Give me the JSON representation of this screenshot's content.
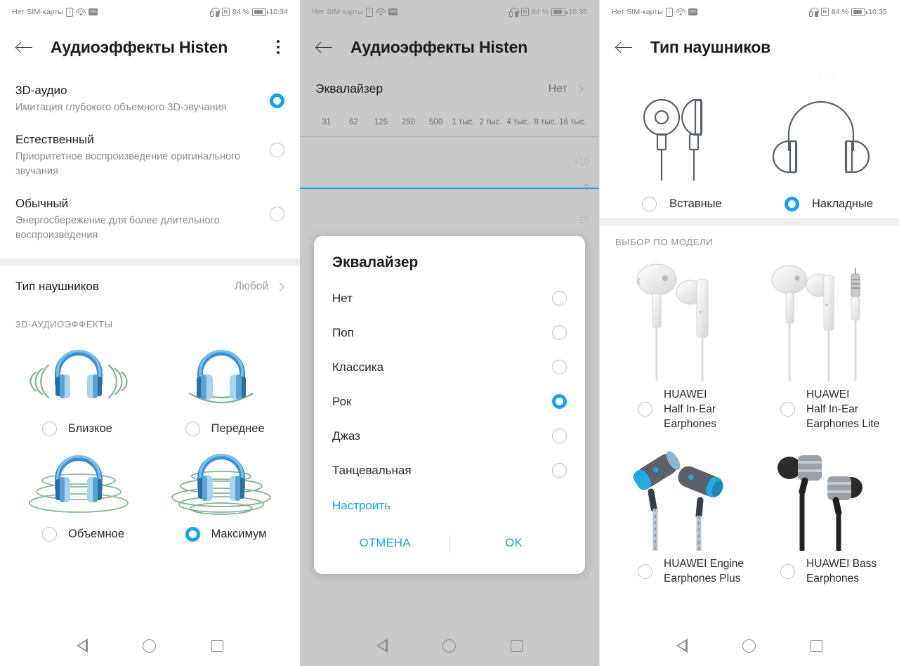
{
  "statusbar": {
    "sim_text": "Нет SIM-карты",
    "battery_text": "84 %",
    "time_1": "10:34",
    "time_2": "10:35",
    "time_3": "10:35",
    "icons": [
      "sim-card-icon",
      "wifi-icon",
      "sms-icon",
      "headset-icon",
      "nfc-icon",
      "battery-icon"
    ]
  },
  "screen1": {
    "title": "Аудиоэффекты Histen",
    "modes": [
      {
        "title": "3D-аудио",
        "desc": "Имитация глубокого объемного 3D-звучания",
        "selected": true
      },
      {
        "title": "Естественный",
        "desc": "Приоритетное воспроизведение оригинального звучания",
        "selected": false
      },
      {
        "title": "Обычный",
        "desc": "Энергосбережение для более длительного воспроизведения",
        "selected": false
      }
    ],
    "headphone_row": {
      "label": "Тип наушников",
      "value": "Любой"
    },
    "section_title": "3D-АУДИОЭФФЕКТЫ",
    "effects": [
      {
        "label": "Близкое",
        "selected": false
      },
      {
        "label": "Переднее",
        "selected": false
      },
      {
        "label": "Объемное",
        "selected": false
      },
      {
        "label": "Максимум",
        "selected": true
      }
    ]
  },
  "screen2": {
    "title": "Аудиоэффекты Histen",
    "eq_row": {
      "label": "Эквалайзер",
      "value": "Нет"
    },
    "frequencies": [
      "31",
      "62",
      "125",
      "250",
      "500",
      "1 тыс.",
      "2 тыс.",
      "4 тыс.",
      "8 тыс.",
      "16 тыс."
    ],
    "gain_marks": {
      "plus": "+10",
      "zero": "0",
      "minus": "-10"
    },
    "dialog": {
      "title": "Эквалайзер",
      "options": [
        {
          "label": "Нет",
          "selected": false
        },
        {
          "label": "Поп",
          "selected": false
        },
        {
          "label": "Классика",
          "selected": false
        },
        {
          "label": "Рок",
          "selected": true
        },
        {
          "label": "Джаз",
          "selected": false
        },
        {
          "label": "Танцевальная",
          "selected": false
        }
      ],
      "custom_link": "Настроить",
      "cancel": "ОТМЕНА",
      "ok": "OK"
    }
  },
  "screen3": {
    "title": "Тип наушников",
    "types": [
      {
        "label": "Вставные",
        "selected": false
      },
      {
        "label": "Накладные",
        "selected": true
      }
    ],
    "section_title": "ВЫБОР ПО МОДЕЛИ",
    "models": [
      {
        "label": "HUAWEI\nHalf In-Ear\nEarphones",
        "selected": false
      },
      {
        "label": "HUAWEI\nHalf In-Ear\nEarphones Lite",
        "selected": false
      },
      {
        "label": "HUAWEI Engine\nEarphones Plus",
        "selected": false
      },
      {
        "label": "HUAWEI Bass\nEarphones",
        "selected": false
      }
    ]
  },
  "navbar": {
    "back": "nav-back-icon",
    "home": "nav-home-icon",
    "recents": "nav-recents-icon"
  },
  "colors": {
    "accent": "#13a3f0",
    "scrim": "#c9c9c9",
    "text": "#1c1c1c",
    "muted": "#8c8c8c"
  }
}
